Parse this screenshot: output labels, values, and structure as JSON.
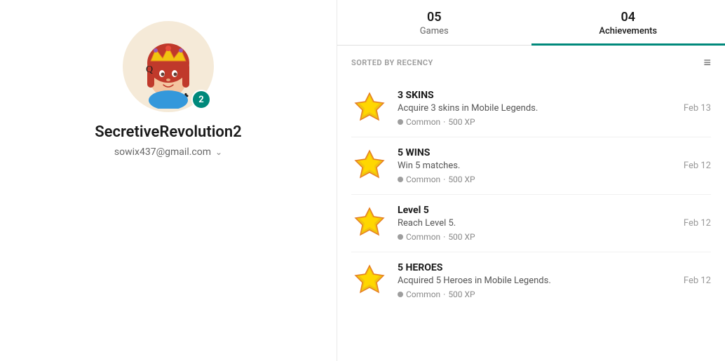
{
  "colors": {
    "accent": "#00897b",
    "badge_bg": "#00897b",
    "text_primary": "#1a1a1a",
    "text_secondary": "#666",
    "text_muted": "#999"
  },
  "left_panel": {
    "username": "SecretiveRevolution2",
    "email": "sowix437@gmail.com",
    "level": "2"
  },
  "tabs": [
    {
      "number": "05",
      "label": "Games",
      "active": false
    },
    {
      "number": "04",
      "label": "Achievements",
      "active": true
    }
  ],
  "achievements": {
    "sorted_by_label": "SORTED BY RECENCY",
    "items": [
      {
        "title": "3 SKINS",
        "description": "Acquire 3 skins in Mobile Legends.",
        "rarity": "Common",
        "xp": "500 XP",
        "date": "Feb 13"
      },
      {
        "title": "5 WINS",
        "description": "Win 5 matches.",
        "rarity": "Common",
        "xp": "500 XP",
        "date": "Feb 12"
      },
      {
        "title": "Level 5",
        "description": "Reach Level 5.",
        "rarity": "Common",
        "xp": "500 XP",
        "date": "Feb 12"
      },
      {
        "title": "5 HEROES",
        "description": "Acquired 5 Heroes in Mobile Legends.",
        "rarity": "Common",
        "xp": "500 XP",
        "date": "Feb 12"
      }
    ]
  }
}
